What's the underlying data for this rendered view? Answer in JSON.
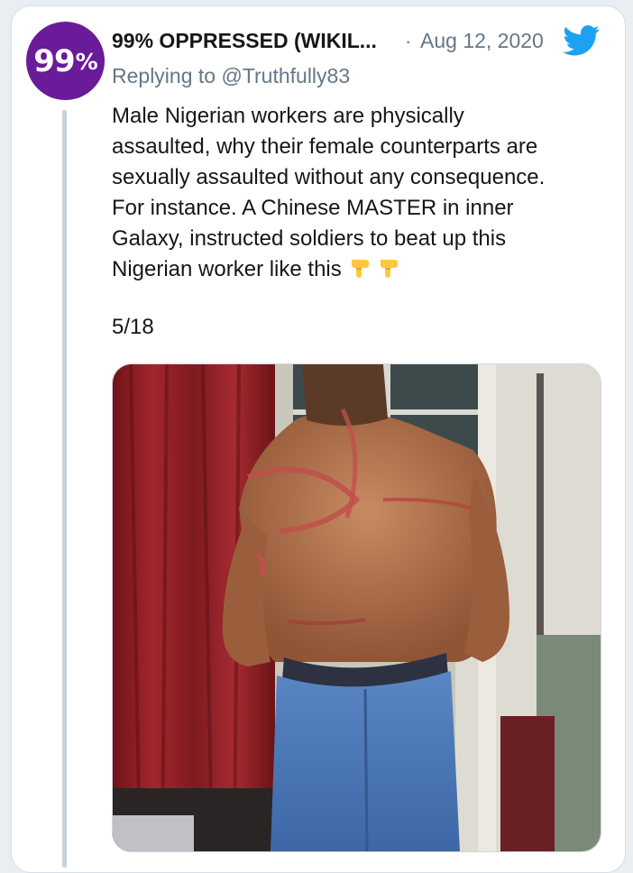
{
  "tweet": {
    "avatar_text": "99",
    "avatar_pct": "%",
    "display_name": "99% OPPRESSED (WIKIL...",
    "separator": "·",
    "date": "Aug 12, 2020",
    "replying_prefix": "Replying to ",
    "replying_handle": "@Truthfully83",
    "body_lines": [
      "Male Nigerian workers are physically",
      "assaulted, why their female counterparts are",
      "sexually assaulted without any consequence.",
      "For instance. A Chinese MASTER in inner",
      "Galaxy, instructed soldiers to beat up this",
      "Nigerian worker like this"
    ],
    "emoji": [
      "point-down-emoji",
      "point-down-emoji"
    ],
    "thread_counter": "5/18",
    "media": {
      "icon": "photo",
      "description_colors": {
        "curtain": "#8e1f26",
        "skin": "#b5714c",
        "jeans": "#4a78b8",
        "wall": "#dcd9d0"
      }
    }
  },
  "colors": {
    "avatar_bg": "#6a1b9a",
    "twitter_blue": "#1da1f2",
    "muted_text": "#657786",
    "text": "#14171a"
  }
}
